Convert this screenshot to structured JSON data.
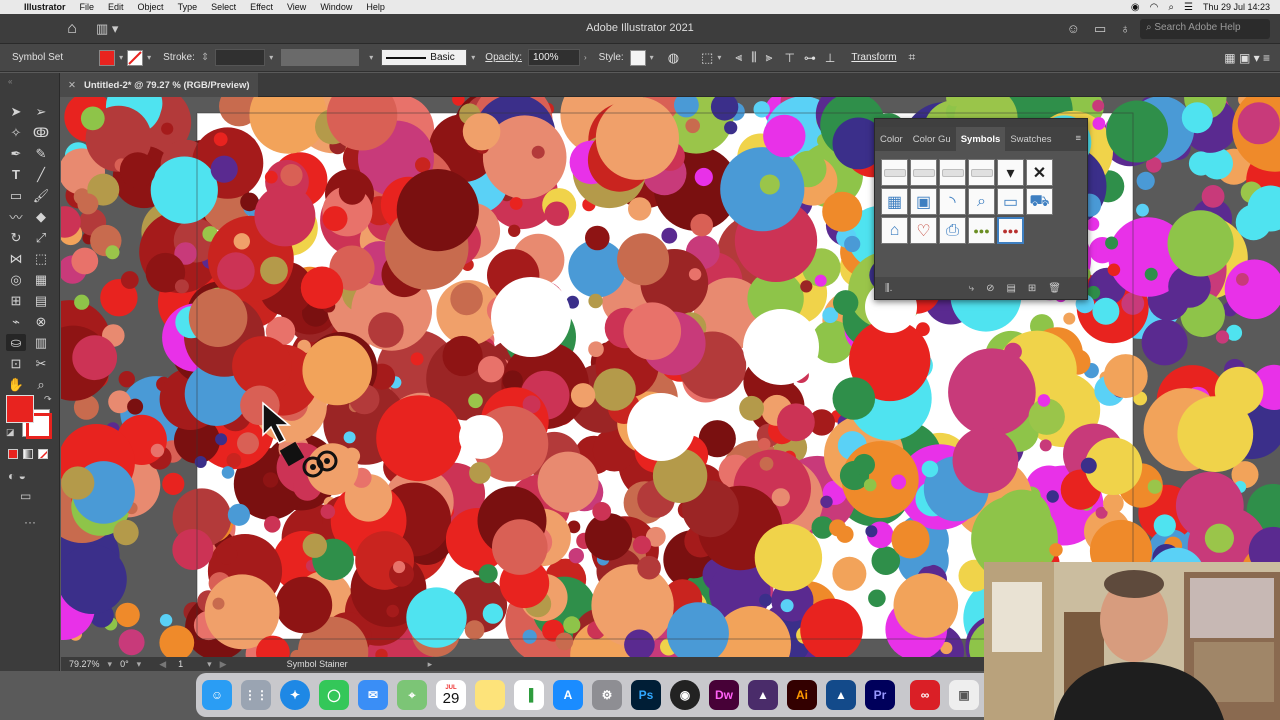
{
  "menubar": {
    "app": "Illustrator",
    "menus": [
      "File",
      "Edit",
      "Object",
      "Type",
      "Select",
      "Effect",
      "View",
      "Window",
      "Help"
    ],
    "clock": "Thu 29 Jul  14:23"
  },
  "appbar": {
    "title": "Adobe Illustrator 2021",
    "search_placeholder": "Search Adobe Help"
  },
  "control": {
    "selection": "Symbol Set",
    "stroke_label": "Stroke:",
    "brush_label": "Basic",
    "opacity_label": "Opacity:",
    "opacity_value": "100%",
    "style_label": "Style:",
    "transform_label": "Transform",
    "fill_color": "#e8231f"
  },
  "document": {
    "tab_title": "Untitled-2* @ 79.27 % (RGB/Preview)"
  },
  "status": {
    "zoom": "79.27%",
    "rotation": "0°",
    "artboard": "1",
    "tool": "Symbol Stainer"
  },
  "panel": {
    "tabs": [
      "Color",
      "Color Gu",
      "Symbols",
      "Swatches"
    ],
    "active_tab": "Symbols",
    "symbols": [
      "bar-symbol",
      "bar-symbol",
      "bar-symbol",
      "bar-symbol",
      "dropdown-symbol",
      "close-symbol",
      "table-symbol",
      "browser-symbol",
      "rss-symbol",
      "magnifier-symbol",
      "card-symbol",
      "cart-symbol",
      "home-symbol",
      "heart-plus-symbol",
      "printer-symbol",
      "dots-symbol",
      "dots-set-symbol"
    ]
  },
  "dock": {
    "date_month": "JUL",
    "date_day": "29",
    "apps": [
      "finder",
      "launchpad",
      "safari",
      "messages",
      "mail",
      "maps",
      "calendar",
      "notes",
      "numbers",
      "app-store",
      "system-preferences",
      "photoshop",
      "obs",
      "dreamweaver",
      "affinity",
      "illustrator",
      "affinity-designer",
      "premiere",
      "creative-cloud",
      "preview"
    ],
    "ps_label": "Ps",
    "dw_label": "Dw",
    "ai_label": "Ai",
    "pr_label": "Pr"
  }
}
